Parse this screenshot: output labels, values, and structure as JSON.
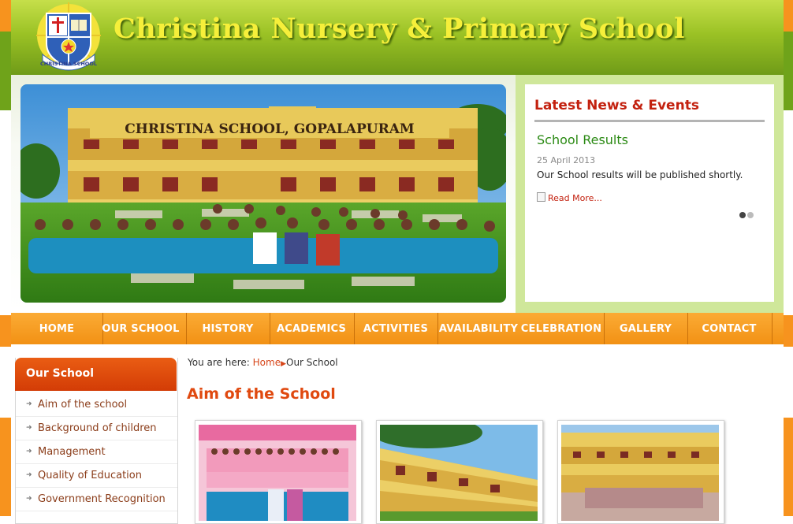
{
  "header": {
    "site_title": "Christina Nursery & Primary School",
    "logo_text": "CHRISTINA SCHOOL"
  },
  "banner": {
    "building_sign": "CHRISTINA SCHOOL, GOPALAPURAM"
  },
  "news": {
    "title": "Latest News & Events",
    "item_title": "School Results",
    "item_date": "25 April 2013",
    "item_text": "Our School results will be published shortly.",
    "read_more": "Read More..."
  },
  "nav": {
    "items": [
      "HOME",
      "OUR SCHOOL",
      "HISTORY",
      "ACADEMICS",
      "ACTIVITIES",
      "AVAILABILITY",
      "CELEBRATION",
      "GALLERY",
      "CONTACT"
    ]
  },
  "sidebar": {
    "title": "Our School",
    "items": [
      "Aim of the school",
      "Background of children",
      "Management",
      "Quality of Education",
      "Government Recognition"
    ]
  },
  "breadcrumb": {
    "prefix": "You are here:",
    "home": "Home",
    "current": "Our School"
  },
  "main": {
    "title": "Aim of the School"
  },
  "colors": {
    "header_green": "#8cb51f",
    "title_yellow": "#f6ef3a",
    "nav_orange": "#f29114",
    "accent_red": "#c3210f",
    "news_green": "#2b8a14",
    "sidebar_orange": "#e04f0d"
  }
}
